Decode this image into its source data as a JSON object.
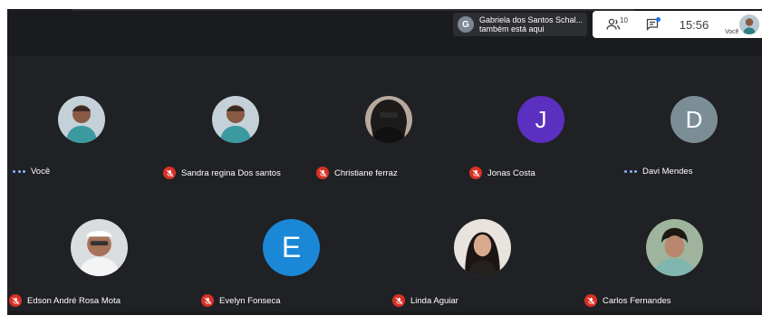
{
  "notification": {
    "avatar_letter": "G",
    "name": "Gabriela dos Santos Schal...",
    "message": "também está aqui"
  },
  "toolbar": {
    "people_count": "10",
    "time": "15:56",
    "self_label": "Você"
  },
  "participants": [
    {
      "name": "Você",
      "status": "speaking",
      "avatar": "photo"
    },
    {
      "name": "Sandra regina Dos santos",
      "status": "muted",
      "avatar": "photo"
    },
    {
      "name": "Christiane ferraz",
      "status": "muted",
      "avatar": "photo"
    },
    {
      "name": "Jonas Costa",
      "status": "muted",
      "avatar": "J",
      "avatar_color": "#5b2fc0"
    },
    {
      "name": "Davi Mendes",
      "status": "speaking",
      "avatar": "D",
      "avatar_color": "#7b8e96"
    },
    {
      "name": "Edson André Rosa Mota",
      "status": "muted",
      "avatar": "photo"
    },
    {
      "name": "Evelyn Fonseca",
      "status": "muted",
      "avatar": "E",
      "avatar_color": "#1a88d6"
    },
    {
      "name": "Linda Aguiar",
      "status": "muted",
      "avatar": "photo"
    },
    {
      "name": "Carlos Fernandes",
      "status": "muted",
      "avatar": "photo"
    }
  ],
  "colors": {
    "background": "#202124",
    "muted_badge": "#d93025",
    "speaking_dots": "#8ab4f8",
    "toolbar_bg": "#ffffff"
  },
  "icons": {
    "people": "people-icon",
    "chat": "chat-icon",
    "muted": "mic-off-icon",
    "speaking": "audio-dots-icon"
  }
}
